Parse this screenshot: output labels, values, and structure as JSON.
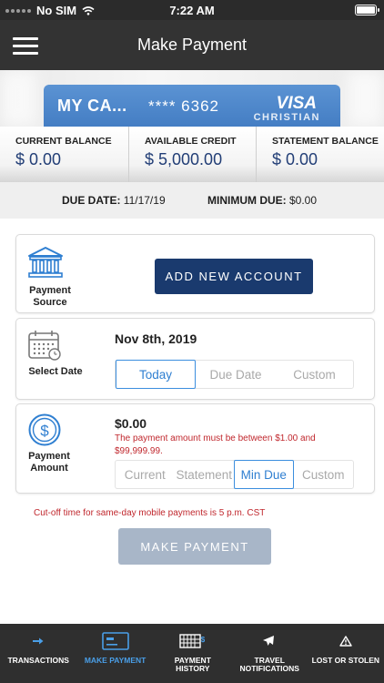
{
  "status_bar": {
    "carrier": "No SIM",
    "time": "7:22 AM"
  },
  "header": {
    "title": "Make Payment"
  },
  "card": {
    "name": "MY CA...",
    "masked_number": "**** 6362",
    "brand": "VISA",
    "issuer": "CHRISTIAN"
  },
  "balances": [
    {
      "label": "CURRENT BALANCE",
      "value": "$ 0.00"
    },
    {
      "label": "AVAILABLE CREDIT",
      "value": "$ 5,000.00"
    },
    {
      "label": "STATEMENT BALANCE",
      "value": "$ 0.00"
    }
  ],
  "due": {
    "due_date_label": "DUE DATE:",
    "due_date_value": "11/17/19",
    "min_due_label": "MINIMUM DUE:",
    "min_due_value": "$0.00"
  },
  "payment_source": {
    "label": "Payment Source",
    "button": "ADD NEW ACCOUNT",
    "icon": "bank-icon"
  },
  "select_date": {
    "label": "Select Date",
    "value": "Nov 8th, 2019",
    "icon": "calendar-icon",
    "options": [
      "Today",
      "Due Date",
      "Custom"
    ],
    "selected": "Today"
  },
  "payment_amount": {
    "label": "Payment Amount",
    "value": "$0.00",
    "error": "The payment amount must be between $1.00 and $99,999.99.",
    "icon": "dollar-icon",
    "options": [
      "Current",
      "Statement",
      "Min Due",
      "Custom"
    ],
    "selected": "Min Due"
  },
  "cutoff_note": "Cut-off time for same-day mobile payments is 5 p.m. CST",
  "submit": {
    "label": "MAKE PAYMENT"
  },
  "tabs": [
    {
      "label": "TRANSACTIONS",
      "icon": "arrow-right-icon"
    },
    {
      "label": "MAKE PAYMENT",
      "icon": "card-icon",
      "active": true
    },
    {
      "label": "PAYMENT HISTORY",
      "icon": "calendar-grid-icon"
    },
    {
      "label": "TRAVEL NOTIFICATIONS",
      "icon": "airplane-icon"
    },
    {
      "label": "LOST OR STOLEN",
      "icon": "warning-icon"
    }
  ],
  "colors": {
    "accent": "#2f7fd1",
    "primary_button": "#1a3a6e",
    "error": "#c0272d",
    "disabled_button": "#a8b6c8",
    "header": "#333333"
  }
}
